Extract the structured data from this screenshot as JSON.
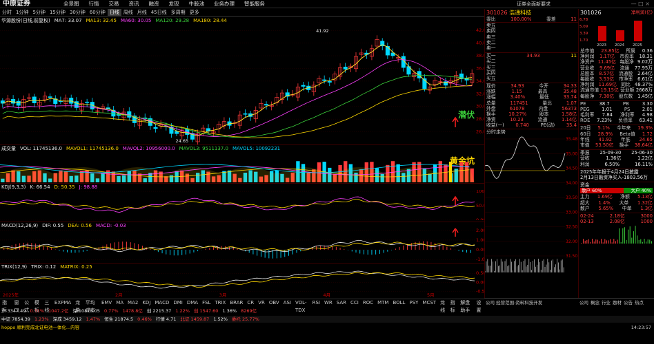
{
  "app": {
    "logo": "中原证券",
    "window_controls": "— □ ×"
  },
  "menu": [
    "全景图",
    "行情",
    "交易",
    "资讯",
    "融资",
    "发现",
    "牛股池",
    "业务办理",
    "智能服务"
  ],
  "top_right": "证券全面新要求",
  "period_tabs": [
    "分时",
    "1分钟",
    "5分钟",
    "15分钟",
    "30分钟",
    "60分钟",
    "日线",
    "周线",
    "月线",
    "45日线",
    "多周期",
    "更多"
  ],
  "main_legend": {
    "title": "华源股份(日线,前复权)",
    "ma": [
      {
        "label": "MA7: 33.07",
        "color": "#e8e8e8"
      },
      {
        "label": "MA13: 32.45",
        "color": "#ffd800"
      },
      {
        "label": "MA60: 30.05",
        "color": "#ff40ff"
      },
      {
        "label": "MA120: 29.28",
        "color": "#3bd13b"
      },
      {
        "label": "MA180: 28.44",
        "color": "#ffd800"
      }
    ]
  },
  "price_axis": [
    "42.00",
    "40.00",
    "38.00",
    "36.00",
    "34.00",
    "32.00",
    "30.00",
    "28.00",
    "26.00"
  ],
  "annotations": {
    "high": "41.92",
    "low": "24.65",
    "qianfu": "潜伏",
    "huangjinkeng": "黄金坑"
  },
  "vol_legend": [
    "成交量",
    "VOL: 11745136.0",
    "MAVOL1: 11745136.0",
    "MAVOL2: 10956000.0",
    "MAVOL3: 9511137.0",
    "MAVOL5: 10092231"
  ],
  "kdj_legend": [
    "KDJ(9,3,3)",
    "K: 66.54",
    "D: 50.35",
    "J: 98.88"
  ],
  "kdj_axis": [
    "100.00",
    "50.00",
    "0.00"
  ],
  "macd_legend": [
    "MACD(12,26,9)",
    "DIF: 0.55",
    "DEA: 0.56",
    "MACD: -0.03"
  ],
  "macd_axis": [
    "2.00",
    "1.00",
    "0.00",
    "-1.00"
  ],
  "trix_legend": [
    "TRIX(12,9)",
    "TRIX: 0.12",
    "MATRIX: 0.25"
  ],
  "trix_axis": [
    "0.50",
    "0.00",
    "-0.50"
  ],
  "time_axis": [
    "2025年",
    "2月",
    "3月",
    "4月",
    "5月"
  ],
  "bottom_tabs": [
    "指标A",
    "窗口",
    "公式",
    "模板",
    "三线",
    "EXPMA",
    "龙量",
    "平均成本",
    "EMV",
    "MA",
    "MA2",
    "KDJ",
    "MACD",
    "DMI",
    "DMA",
    "FSL",
    "TRIX",
    "BRAR",
    "CR",
    "VR",
    "OBV",
    "ASI",
    "VOL-TDX",
    "RSI",
    "WR",
    "SAR",
    "CCI",
    "ROC",
    "MTM",
    "BOLL",
    "PSY",
    "MCST",
    "龙线",
    "指标",
    "解盘助手",
    "设置"
  ],
  "stock": {
    "code": "301026",
    "name": "浩通科技",
    "change": "+3.40%"
  },
  "order_book": {
    "title_left": "委比",
    "ratio": "100.00%",
    "title_right": "委差",
    "diff": "11",
    "sells": [
      [
        "卖五",
        "",
        ""
      ],
      [
        "卖四",
        "",
        ""
      ],
      [
        "卖三",
        "",
        ""
      ],
      [
        "卖二",
        "",
        ""
      ],
      [
        "卖一",
        "",
        ""
      ]
    ],
    "buys": [
      [
        "买一",
        "34.93",
        "11"
      ],
      [
        "买二",
        "",
        ""
      ],
      [
        "买三",
        "",
        ""
      ],
      [
        "买四",
        "",
        ""
      ],
      [
        "买五",
        "",
        ""
      ]
    ]
  },
  "quote": [
    [
      "现价",
      "34.93",
      "今开",
      "34.33"
    ],
    [
      "涨跌",
      "1.15",
      "最高",
      "35.48"
    ],
    [
      "涨幅",
      "3.40%",
      "最低",
      "33.74"
    ],
    [
      "总量",
      "117451",
      "量比",
      "1.07"
    ],
    [
      "外盘",
      "61078",
      "内盘",
      "56373"
    ],
    [
      "换手",
      "10.27%",
      "股本",
      "1.58亿"
    ],
    [
      "净资",
      "10.23",
      "流通",
      "1.14亿"
    ],
    [
      "收益(一)",
      "0.740",
      "PE(动)",
      "35.4"
    ]
  ],
  "mini_chart": {
    "title": "分时走势",
    "axis": [
      "35.48",
      "35.00",
      "34.50",
      "34.00",
      "33.50",
      "33.00",
      "32.50",
      "32.00",
      "31.50"
    ]
  },
  "right_panel": {
    "code": "301026",
    "mini_price": [
      "6.78",
      "5.09",
      "3.39",
      "1.70"
    ],
    "years": [
      "2023",
      "2024",
      "2025"
    ],
    "title_right": "净利润(亿)",
    "fin": [
      [
        "总市值",
        "23.85亿",
        "所属",
        "0.36"
      ],
      [
        "净利润",
        "1.17亿",
        "市盈率",
        "18.31"
      ],
      [
        "净资产",
        "11.45亿",
        "每股净",
        "9.02万"
      ],
      [
        "营业收",
        "9.69亿",
        "流通",
        "77.95万"
      ],
      [
        "总股本",
        "8.57亿",
        "流通股",
        "2.64亿"
      ],
      [
        "每股收",
        "3.53亿",
        "市净率",
        "6.61亿"
      ],
      [
        "净利润",
        "11.69亿",
        "同比",
        "48.37%"
      ],
      [
        "流通市值",
        "19.15亿",
        "营业额",
        "2668万"
      ],
      [
        "每股净",
        "7.38亿",
        "股东数",
        "1.45亿"
      ]
    ],
    "ratios": [
      [
        "PE",
        "38.7",
        "PB",
        "3.30"
      ],
      [
        "PEG",
        "1.01",
        "PS",
        "2.01"
      ],
      [
        "毛利率",
        "7.84",
        "净利率",
        "4.98"
      ],
      [
        "ROE",
        "7.23%",
        "负债率",
        "63.41"
      ]
    ],
    "returns": [
      [
        "20日",
        "5.1%",
        "今年来",
        "19.3%"
      ],
      [
        "60日",
        "28.9%",
        "Beta值",
        "1.72"
      ],
      [
        "年线",
        "41.92",
        "年低",
        "24.65"
      ],
      [
        "市值",
        "53.50亿",
        "换手",
        "38.64亿"
      ]
    ],
    "periods": [
      [
        "季报",
        "25-09-30",
        "25-06-30"
      ],
      [
        "营收",
        "1.36亿",
        "1.22亿"
      ],
      [
        "利润",
        "6.50%",
        "16.11%"
      ]
    ],
    "news": [
      "2025年年报于4月24日披露",
      "2月13日融资净买入-1803.56万"
    ],
    "flow_title": "资金",
    "flow_labels": [
      "散户",
      "大户"
    ],
    "flow": [
      "60%",
      "40%"
    ],
    "flow_rows": [
      [
        "主力",
        "1.69亿",
        "净额",
        "5.13亿"
      ],
      [
        "超大",
        "1.4%",
        "大单",
        "1.32亿"
      ],
      [
        "散户",
        "5.65%",
        "中单",
        "1.3亿"
      ]
    ],
    "trades": [
      [
        "02-24",
        "2.18亿",
        "3000"
      ],
      [
        "02-13",
        "2.08亿",
        "1000"
      ]
    ],
    "tags": [
      "公司",
      "概念",
      "行业",
      "题材",
      "公告",
      "热点"
    ],
    "bottom_notes": [
      "公司 经营范围:资料科技开发",
      "行业 ...",
      "主营 资金在投资证券投资"
    ]
  },
  "status": {
    "row1": [
      "沪 3347.49",
      "0.31%",
      "1047.2亿",
      "深 10875.05",
      "0.77%",
      "1478.8亿",
      "创 2215.37",
      "1.22%",
      "创 1547.60",
      "1.36%",
      "8269亿"
    ],
    "row2": [
      "中证 7854.39",
      "1.23%",
      "深成 3459.12",
      "1.47%",
      "恒生 21874.5",
      "0.46%",
      "行情 4.71",
      "北证 1459.87",
      "1.52%",
      "委托 25.77%"
    ],
    "news_ticker": "hoppo 顺利完成北证电池一体化...内容",
    "time": "14:23:57"
  },
  "chart_data": [
    {
      "type": "candlestick",
      "title": "华源股份(日线,前复权)",
      "ylim": [
        24,
        43
      ],
      "x": [
        "2024-12",
        "2025-01",
        "2025-02",
        "2025-03",
        "2025-04",
        "2025-05"
      ],
      "close": [
        30.5,
        31.2,
        29.8,
        27.6,
        25.3,
        27.9,
        31.8,
        34.5,
        40.1,
        33.2,
        34.9
      ],
      "high_label": 41.92,
      "low_label": 24.65
    },
    {
      "type": "bar",
      "title": "成交量",
      "values": [
        3,
        4,
        5,
        3,
        6,
        4,
        5,
        7,
        8,
        6,
        5,
        4,
        7,
        9,
        12,
        10,
        8,
        6,
        5,
        7
      ]
    },
    {
      "type": "line",
      "title": "KDJ(9,3,3)",
      "series": [
        {
          "name": "K",
          "values": [
            60,
            70,
            40,
            30,
            55,
            75,
            50,
            35,
            60,
            80,
            45,
            40,
            66
          ]
        },
        {
          "name": "D",
          "values": [
            55,
            60,
            50,
            40,
            50,
            65,
            55,
            45,
            55,
            70,
            55,
            45,
            50
          ]
        }
      ]
    },
    {
      "type": "line",
      "title": "MACD(12,26,9)",
      "series": [
        {
          "name": "DIF",
          "values": [
            0.2,
            0.5,
            0.3,
            -0.1,
            0.2,
            0.4,
            0.1,
            -0.2,
            0.3,
            0.9,
            0.6,
            0.4,
            0.55
          ]
        },
        {
          "name": "DEA",
          "values": [
            0.1,
            0.3,
            0.35,
            0.1,
            0.1,
            0.3,
            0.2,
            0,
            0.1,
            0.6,
            0.7,
            0.5,
            0.56
          ]
        }
      ]
    },
    {
      "type": "line",
      "title": "TRIX(12,9)",
      "series": [
        {
          "name": "TRIX",
          "values": [
            0.1,
            0.3,
            0.2,
            -0.1,
            -0.3,
            -0.2,
            0.1,
            0.3,
            0.5,
            0.6,
            0.4,
            0.2,
            0.12
          ]
        },
        {
          "name": "MATRIX",
          "values": [
            0.05,
            0.2,
            0.25,
            0.1,
            -0.1,
            -0.25,
            -0.1,
            0.15,
            0.35,
            0.5,
            0.5,
            0.35,
            0.25
          ]
        }
      ]
    }
  ]
}
